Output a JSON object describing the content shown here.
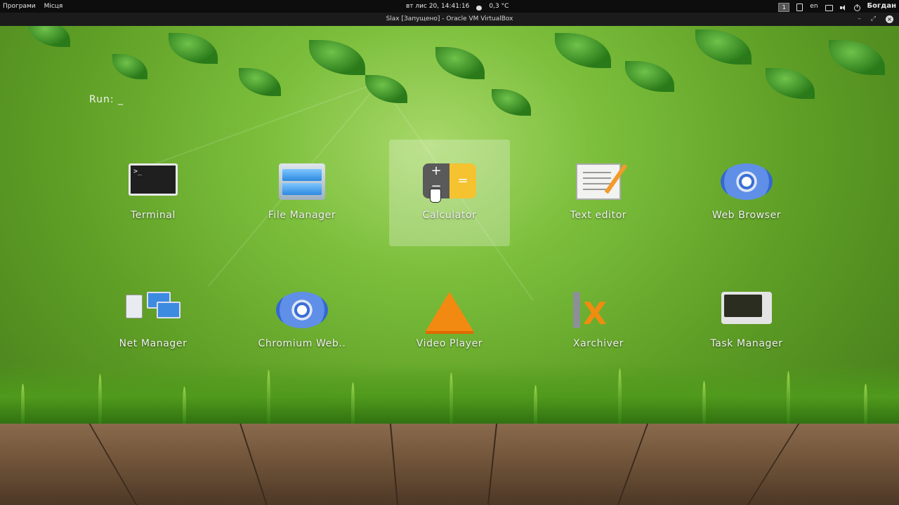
{
  "topbar": {
    "menu_apps": "Програми",
    "menu_places": "Місця",
    "datetime": "вт лис 20, 14:41:16",
    "weather": "0,3 °C",
    "workspace": "1",
    "keyboard_layout": "en",
    "user": "Богдан"
  },
  "window": {
    "title": "Slax [Запущено] - Oracle VM VirtualBox",
    "minimize": "–",
    "maximize": "⤢",
    "close": "×"
  },
  "desktop": {
    "run_label": "Run:  _",
    "apps": [
      {
        "label": "Terminal",
        "icon": "terminal-icon"
      },
      {
        "label": "File Manager",
        "icon": "file-manager-icon"
      },
      {
        "label": "Calculator",
        "icon": "calculator-icon",
        "selected": true
      },
      {
        "label": "Text editor",
        "icon": "text-editor-icon"
      },
      {
        "label": "Web Browser",
        "icon": "web-browser-icon"
      },
      {
        "label": "Net Manager",
        "icon": "net-manager-icon"
      },
      {
        "label": "Chromium Web..",
        "icon": "chromium-icon"
      },
      {
        "label": "Video Player",
        "icon": "vlc-icon"
      },
      {
        "label": "Xarchiver",
        "icon": "xarchiver-icon"
      },
      {
        "label": "Task Manager",
        "icon": "task-manager-icon"
      }
    ],
    "terminal_prompt": ">_",
    "calc_plus": "+",
    "calc_minus": "−",
    "calc_equals": "="
  },
  "colors": {
    "panel": "#0d0d0d",
    "selection": "rgba(255,255,255,0.25)",
    "calc_accent": "#f5c230"
  }
}
